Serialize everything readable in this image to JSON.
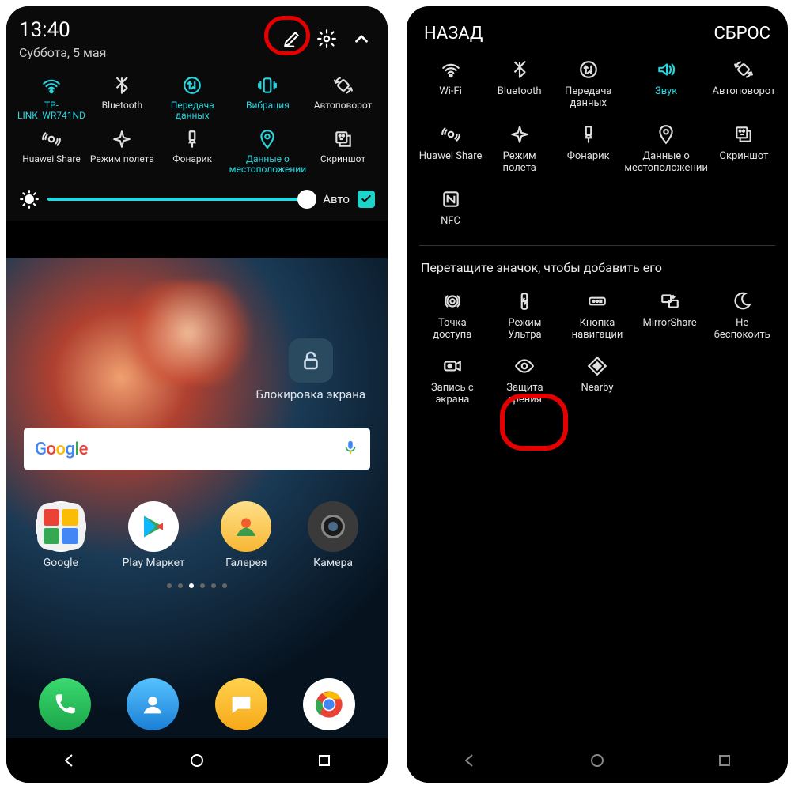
{
  "left": {
    "time": "13:40",
    "date": "Суббота, 5 мая",
    "brightness": {
      "auto_label": "Авто",
      "checked": true
    },
    "tiles": [
      {
        "icon": "wifi-icon",
        "label": "TP-LINK_WR741ND",
        "active": true
      },
      {
        "icon": "bluetooth-icon",
        "label": "Bluetooth",
        "active": false
      },
      {
        "icon": "data-transfer-icon",
        "label": "Передача данных",
        "active": true
      },
      {
        "icon": "vibration-icon",
        "label": "Вибрация",
        "active": true
      },
      {
        "icon": "autorotate-icon",
        "label": "Автоповорот",
        "active": false
      },
      {
        "icon": "huawei-share-icon",
        "label": "Huawei Share",
        "active": false
      },
      {
        "icon": "airplane-icon",
        "label": "Режим полета",
        "active": false
      },
      {
        "icon": "flashlight-icon",
        "label": "Фонарик",
        "active": false
      },
      {
        "icon": "location-icon",
        "label": "Данные о местоположении",
        "active": true
      },
      {
        "icon": "screenshot-icon",
        "label": "Скриншот",
        "active": false
      }
    ],
    "lock_widget_label": "Блокировка экрана",
    "search_placeholder": "Google",
    "apps": [
      {
        "label": "Google"
      },
      {
        "label": "Play Маркет"
      },
      {
        "label": "Галерея"
      },
      {
        "label": "Камера"
      }
    ]
  },
  "right": {
    "back_label": "НАЗАД",
    "reset_label": "СБРОС",
    "tiles": [
      {
        "icon": "wifi-icon",
        "label": "Wi-Fi",
        "active": false
      },
      {
        "icon": "bluetooth-icon",
        "label": "Bluetooth",
        "active": false
      },
      {
        "icon": "data-transfer-icon",
        "label": "Передача данных",
        "active": false
      },
      {
        "icon": "sound-icon",
        "label": "Звук",
        "active": true
      },
      {
        "icon": "autorotate-icon",
        "label": "Автоповорот",
        "active": false
      },
      {
        "icon": "huawei-share-icon",
        "label": "Huawei Share",
        "active": false
      },
      {
        "icon": "airplane-icon",
        "label": "Режим полета",
        "active": false
      },
      {
        "icon": "flashlight-icon",
        "label": "Фонарик",
        "active": false
      },
      {
        "icon": "location-icon",
        "label": "Данные о местоположении",
        "active": false
      },
      {
        "icon": "screenshot-icon",
        "label": "Скриншот",
        "active": false
      },
      {
        "icon": "nfc-icon",
        "label": "NFC",
        "active": false
      }
    ],
    "drag_hint": "Перетащите значок, чтобы добавить его",
    "extra_tiles": [
      {
        "icon": "hotspot-icon",
        "label": "Точка доступа"
      },
      {
        "icon": "ultra-battery-icon",
        "label": "Режим Ультра"
      },
      {
        "icon": "nav-button-icon",
        "label": "Кнопка навигации"
      },
      {
        "icon": "mirrorshare-icon",
        "label": "MirrorShare"
      },
      {
        "icon": "dnd-icon",
        "label": "Не беспокоить"
      },
      {
        "icon": "screen-record-icon",
        "label": "Запись с экрана"
      },
      {
        "icon": "eye-comfort-icon",
        "label": "Защита зрения"
      },
      {
        "icon": "nearby-icon",
        "label": "Nearby"
      }
    ]
  }
}
